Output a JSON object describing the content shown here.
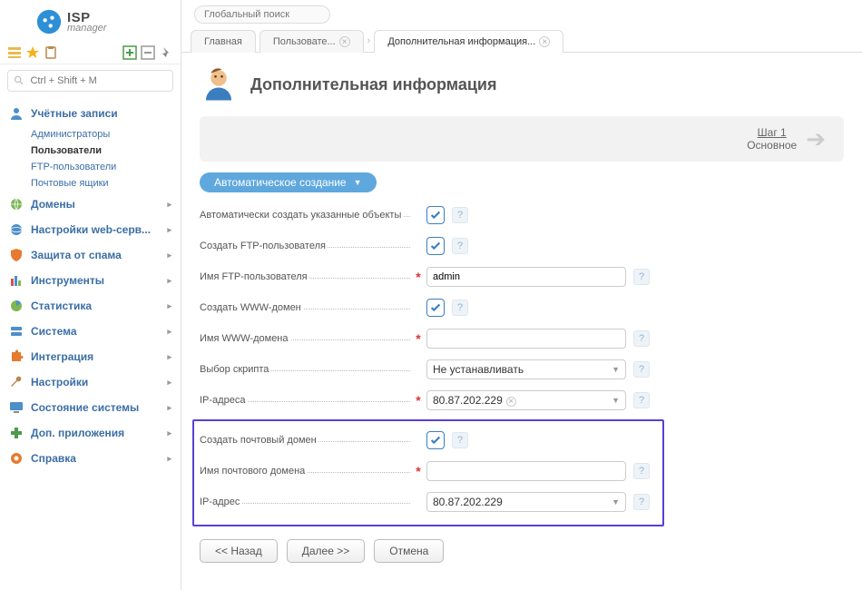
{
  "logo": {
    "brand": "ISP",
    "sub": "manager"
  },
  "sidebar": {
    "search_placeholder": "Ctrl + Shift + M",
    "sections": [
      {
        "label": "Учётные записи",
        "subs": [
          "Администраторы",
          "Пользователи",
          "FTP-пользователи",
          "Почтовые ящики"
        ],
        "active_sub": 1
      },
      {
        "label": "Домены"
      },
      {
        "label": "Настройки web-серв..."
      },
      {
        "label": "Защита от спама"
      },
      {
        "label": "Инструменты"
      },
      {
        "label": "Статистика"
      },
      {
        "label": "Система"
      },
      {
        "label": "Интеграция"
      },
      {
        "label": "Настройки"
      },
      {
        "label": "Состояние системы"
      },
      {
        "label": "Доп. приложения"
      },
      {
        "label": "Справка"
      }
    ]
  },
  "top_search_placeholder": "Глобальный поиск",
  "tabs": [
    {
      "label": "Главная"
    },
    {
      "label": "Пользовате..."
    },
    {
      "label": "Дополнительная информация..."
    }
  ],
  "page_title": "Дополнительная информация",
  "step": {
    "title": "Шаг 1",
    "sub": "Основное"
  },
  "section_title": "Автоматическое создание",
  "form": {
    "auto_create": "Автоматически создать указанные объекты",
    "create_ftp": "Создать FTP-пользователя",
    "ftp_name_label": "Имя FTP-пользователя",
    "ftp_name_value": "admin",
    "create_www": "Создать WWW-домен",
    "www_name_label": "Имя WWW-домена",
    "www_name_value": "",
    "script_label": "Выбор скрипта",
    "script_value": "Не устанавливать",
    "ip_label": "IP-адреса",
    "ip_value": "80.87.202.229",
    "create_mail": "Создать почтовый домен",
    "mail_name_label": "Имя почтового домена",
    "mail_name_value": "",
    "mail_ip_label": "IP-адрес",
    "mail_ip_value": "80.87.202.229"
  },
  "buttons": {
    "back": "<< Назад",
    "next": "Далее >>",
    "cancel": "Отмена"
  }
}
